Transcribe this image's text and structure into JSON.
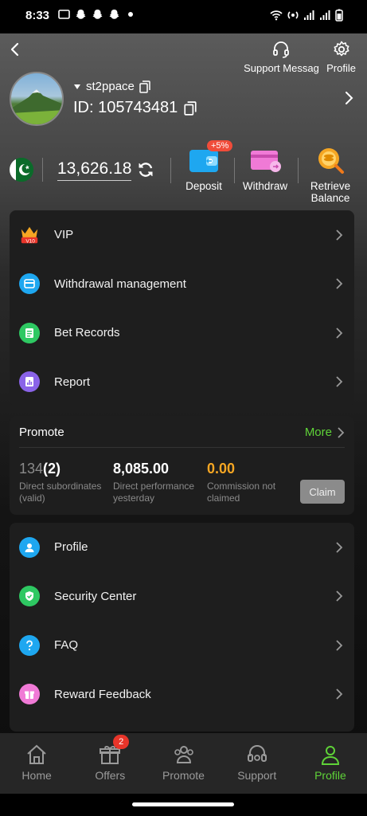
{
  "status": {
    "time": "8:33"
  },
  "header": {
    "support_label": "Support Message",
    "profile_label": "Profile",
    "username": "st2ppace",
    "user_id": "ID: 105743481"
  },
  "wallet": {
    "balance": "13,626.18",
    "deposit_label": "Deposit",
    "deposit_badge": "+5%",
    "withdraw_label": "Withdraw",
    "retrieve_label": "Retrieve Balance"
  },
  "menu1": [
    {
      "label": "VIP",
      "icon": "vip-crown-icon"
    },
    {
      "label": "Withdrawal management",
      "icon": "wallet-card-icon"
    },
    {
      "label": "Bet Records",
      "icon": "document-icon"
    },
    {
      "label": "Report",
      "icon": "report-chart-icon"
    }
  ],
  "promote": {
    "title": "Promote",
    "more": "More",
    "subordinates_total": "134",
    "subordinates_valid": "(2)",
    "subordinates_label": "Direct subordinates (valid)",
    "performance": "8,085.00",
    "performance_label": "Direct performance yesterday",
    "commission": "0.00",
    "commission_label": "Commission not claimed",
    "claim": "Claim"
  },
  "menu2": [
    {
      "label": "Profile",
      "icon": "user-icon"
    },
    {
      "label": "Security Center",
      "icon": "shield-icon"
    },
    {
      "label": "FAQ",
      "icon": "question-icon"
    },
    {
      "label": "Reward Feedback",
      "icon": "gift-icon"
    }
  ],
  "tabs": [
    {
      "label": "Home"
    },
    {
      "label": "Offers",
      "badge": "2"
    },
    {
      "label": "Promote"
    },
    {
      "label": "Support"
    },
    {
      "label": "Profile"
    }
  ],
  "colors": {
    "accent": "#5fd338",
    "commission": "#f5a623"
  }
}
